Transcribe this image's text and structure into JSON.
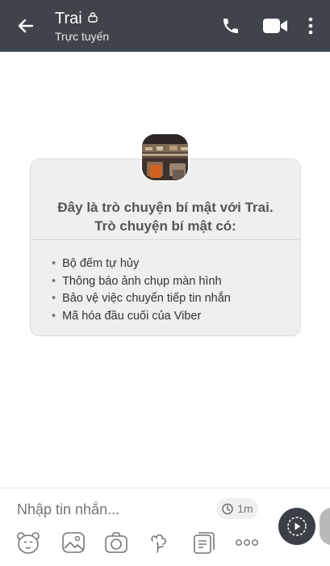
{
  "header": {
    "title": "Trai",
    "status": "Trực tuyến",
    "icons": [
      "back-arrow-icon",
      "lock-icon",
      "phone-icon",
      "video-icon",
      "more-vertical-icon"
    ]
  },
  "chat": {
    "intro_line1": "Đây là trò chuyện bí mật với Trai.",
    "intro_line2": "Trò chuyện bí mật có:",
    "features": [
      "Bộ đếm tự hủy",
      "Thông báo ảnh chụp màn hình",
      "Bảo vệ việc chuyển tiếp tin nhắn",
      "Mã hóa đầu cuối của Viber"
    ]
  },
  "composer": {
    "placeholder": "Nhập tin nhắn...",
    "timer_label": "1m"
  },
  "toolbar": {
    "icons": [
      "sticker-bear-icon",
      "gallery-icon",
      "camera-icon",
      "doodle-icon",
      "more-apps-icon",
      "more-icon"
    ]
  },
  "colors": {
    "header_bg": "#3f434a",
    "card_bg": "#efefef",
    "send_bg": "#3b3f46"
  }
}
